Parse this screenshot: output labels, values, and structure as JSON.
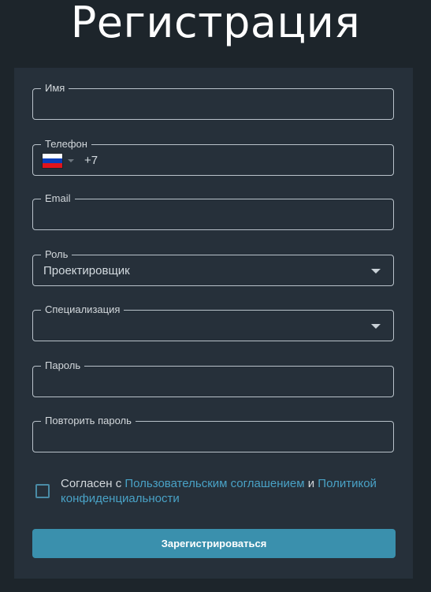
{
  "page": {
    "title": "Регистрация"
  },
  "form": {
    "name_field": {
      "label": "Имя",
      "value": ""
    },
    "phone_field": {
      "label": "Телефон",
      "country": "Россия",
      "code": "+7"
    },
    "email_field": {
      "label": "Email",
      "value": ""
    },
    "role_field": {
      "label": "Роль",
      "value": "Проектировщик"
    },
    "specialization_field": {
      "label": "Специализация",
      "value": ""
    },
    "password_field": {
      "label": "Пароль",
      "value": ""
    },
    "repeat_password_field": {
      "label": "Повторить пароль",
      "value": ""
    },
    "agreement": {
      "checked": false,
      "prefix": "Согласен с ",
      "terms_link": "Пользовательским соглашением",
      "conjunction": " и ",
      "privacy_link": "Политикой конфиденциальности"
    },
    "submit_label": "Зарегистрироваться"
  },
  "colors": {
    "background": "#1d252b",
    "card": "#26303a",
    "accent": "#3a90ad",
    "link": "#49a2c6",
    "border": "#b9c2ca"
  },
  "icons": {
    "flag": "russia-flag-icon",
    "dropdown": "caret-down-icon"
  }
}
